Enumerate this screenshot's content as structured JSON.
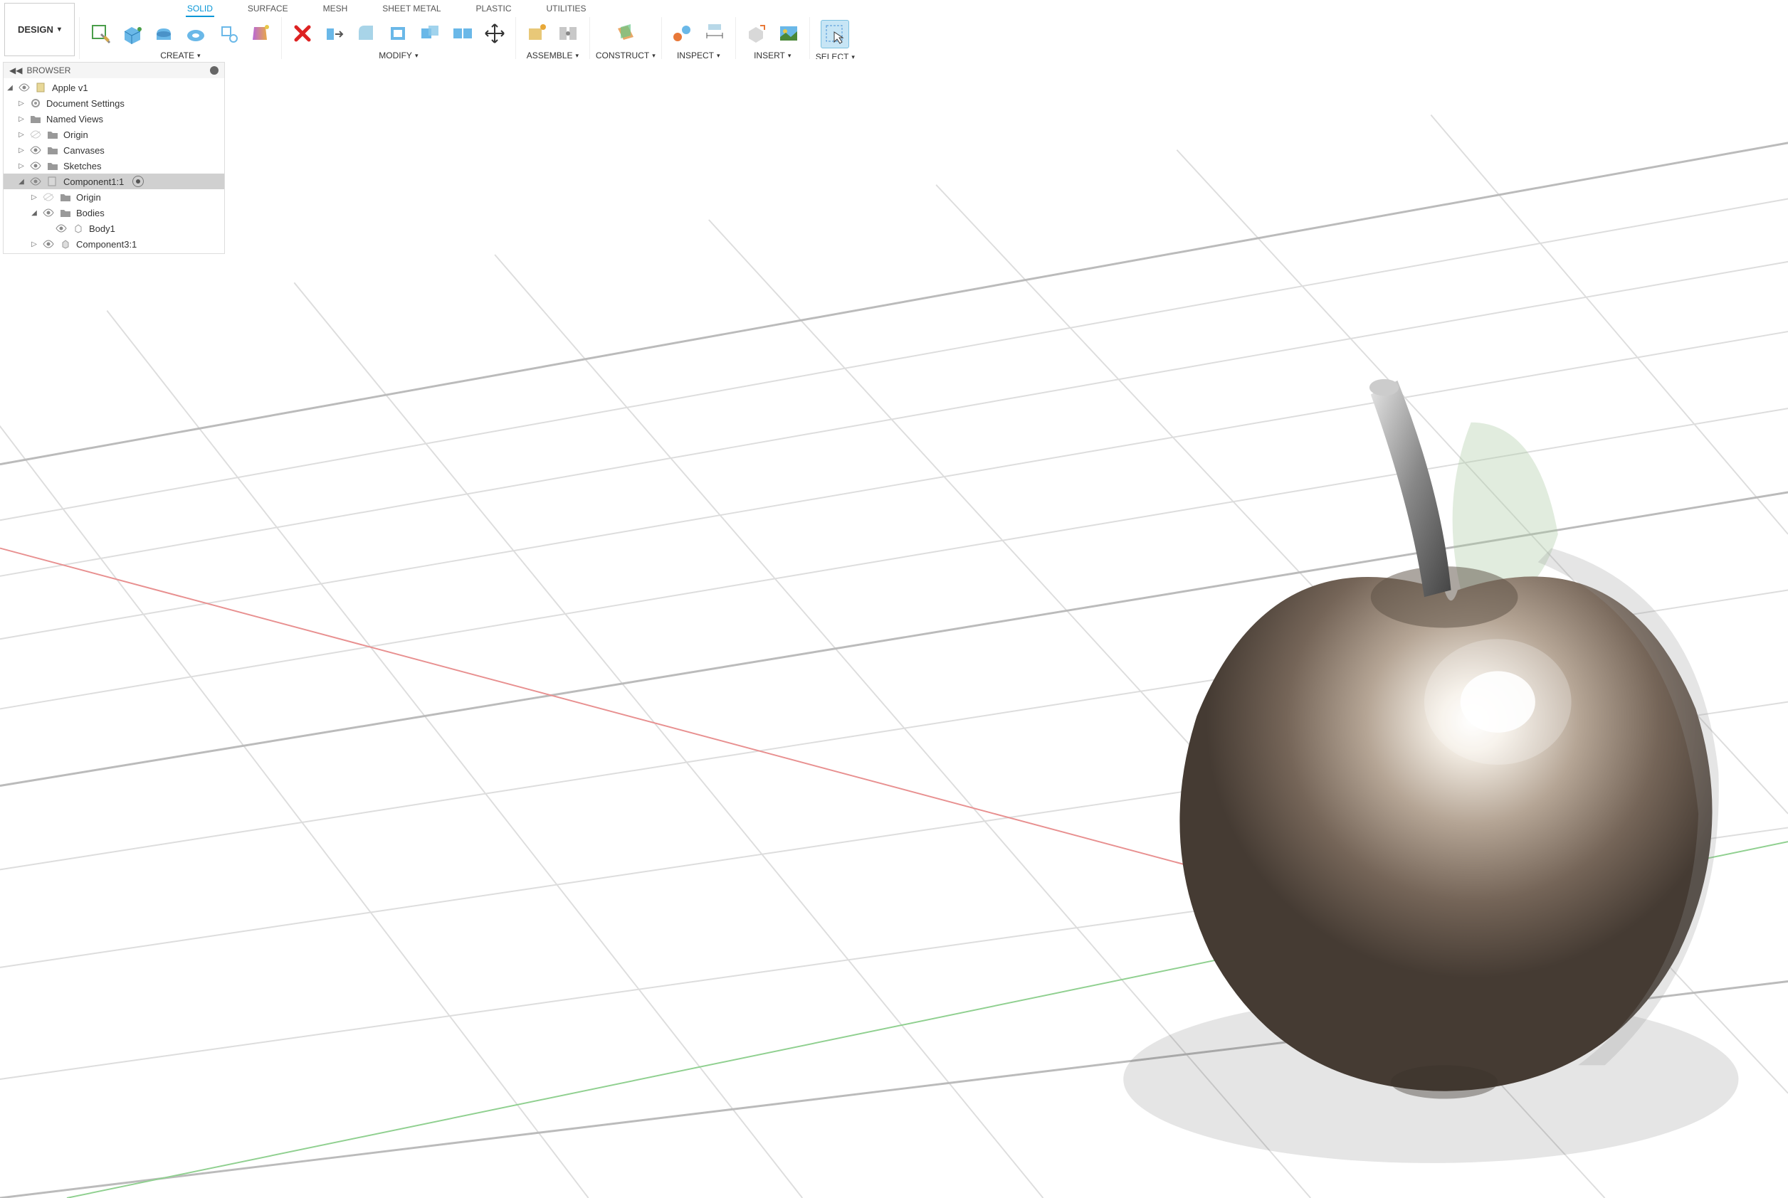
{
  "workspace_button": "DESIGN",
  "ribbon_tabs": [
    "SOLID",
    "SURFACE",
    "MESH",
    "SHEET METAL",
    "PLASTIC",
    "UTILITIES"
  ],
  "active_tab": "SOLID",
  "ribbon_sections": {
    "create": "CREATE",
    "modify": "MODIFY",
    "assemble": "ASSEMBLE",
    "construct": "CONSTRUCT",
    "inspect": "INSPECT",
    "insert": "INSERT",
    "select": "SELECT"
  },
  "browser": {
    "title": "BROWSER",
    "root": "Apple v1",
    "items": [
      {
        "label": "Document Settings"
      },
      {
        "label": "Named Views"
      },
      {
        "label": "Origin"
      },
      {
        "label": "Canvases"
      },
      {
        "label": "Sketches"
      },
      {
        "label": "Component1:1",
        "selected": true,
        "expanded": true
      },
      {
        "label": "Origin",
        "child": true
      },
      {
        "label": "Bodies",
        "child": true,
        "expanded": true
      },
      {
        "label": "Body1",
        "grandchild": true
      },
      {
        "label": "Component3:1",
        "child": true
      }
    ]
  }
}
